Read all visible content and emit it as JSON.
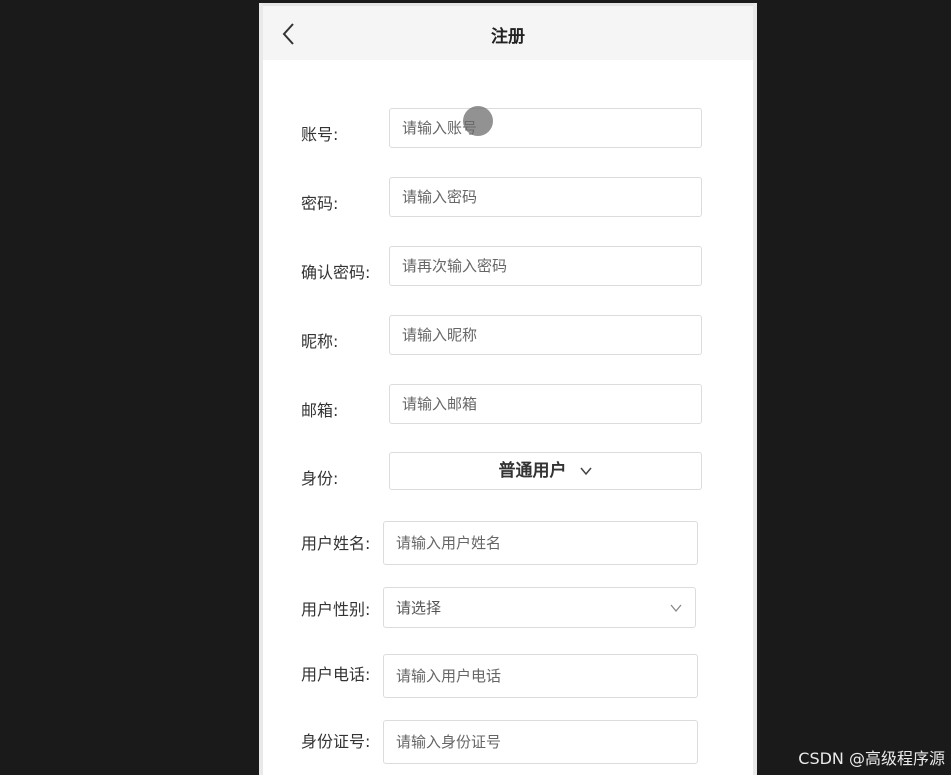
{
  "header": {
    "title": "注册"
  },
  "form": {
    "account": {
      "label": "账号:",
      "placeholder": "请输入账号"
    },
    "password": {
      "label": "密码:",
      "placeholder": "请输入密码"
    },
    "confirm_password": {
      "label": "确认密码:",
      "placeholder": "请再次输入密码"
    },
    "nickname": {
      "label": "昵称:",
      "placeholder": "请输入昵称"
    },
    "email": {
      "label": "邮箱:",
      "placeholder": "请输入邮箱"
    },
    "identity": {
      "label": "身份:",
      "value": "普通用户"
    },
    "user_name": {
      "label": "用户姓名:",
      "placeholder": "请输入用户姓名"
    },
    "user_gender": {
      "label": "用户性别:",
      "value": "请选择"
    },
    "user_phone": {
      "label": "用户电话:",
      "placeholder": "请输入用户电话"
    },
    "id_number": {
      "label": "身份证号:",
      "placeholder": "请输入身份证号"
    }
  },
  "watermark": "CSDN @高级程序源",
  "icons": [
    "chevron-left-icon",
    "chevron-down-icon"
  ]
}
